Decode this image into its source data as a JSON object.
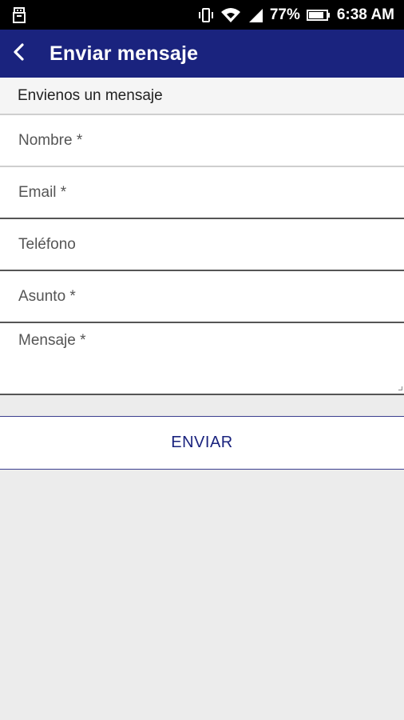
{
  "status_bar": {
    "battery": "77%",
    "time": "6:38 AM",
    "icons": [
      "usb-icon",
      "vibrate-icon",
      "wifi-icon",
      "signal-icon",
      "battery-icon"
    ]
  },
  "app_bar": {
    "title": "Enviar mensaje",
    "back_icon": "back-arrow-icon",
    "color": "#1a237e"
  },
  "section": {
    "header": "Envienos un mensaje"
  },
  "form": {
    "nombre_placeholder": "Nombre *",
    "email_placeholder": "Email *",
    "telefono_placeholder": "Teléfono",
    "asunto_placeholder": "Asunto *",
    "mensaje_placeholder": "Mensaje *",
    "nombre_value": "",
    "email_value": "",
    "telefono_value": "",
    "asunto_value": "",
    "mensaje_value": ""
  },
  "actions": {
    "send_label": "ENVIAR"
  }
}
